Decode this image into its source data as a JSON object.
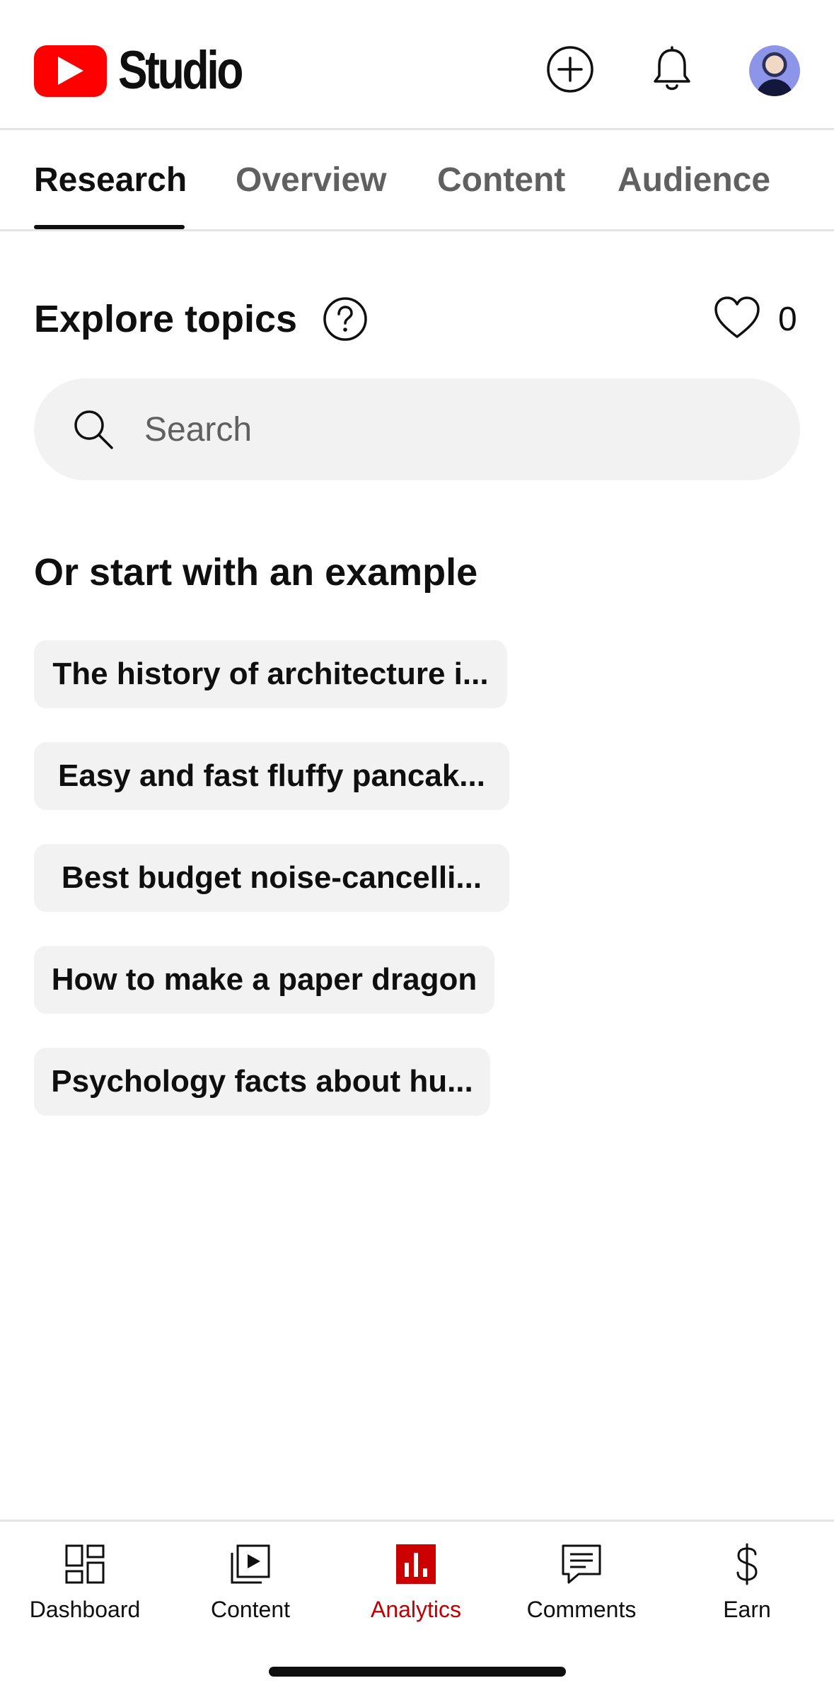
{
  "app": {
    "logo_text": "Studio",
    "accent_color": "#ff0000",
    "active_color": "#c00000"
  },
  "header": {
    "create_icon": "add-circle-icon",
    "notifications_icon": "bell-icon",
    "avatar_icon": "avatar"
  },
  "tabs": [
    {
      "label": "Research",
      "active": true
    },
    {
      "label": "Overview",
      "active": false
    },
    {
      "label": "Content",
      "active": false
    },
    {
      "label": "Audience",
      "active": false
    }
  ],
  "explore": {
    "title": "Explore topics",
    "favorites_count": "0",
    "search_placeholder": "Search"
  },
  "examples": {
    "title": "Or start with an example",
    "chips": [
      "The history of architecture i...",
      "Easy and fast fluffy pancak...",
      "Best budget noise-cancelli...",
      "How to make a paper dragon",
      "Psychology facts about hu..."
    ]
  },
  "bottom_nav": [
    {
      "label": "Dashboard",
      "icon": "dashboard-icon",
      "active": false
    },
    {
      "label": "Content",
      "icon": "video-library-icon",
      "active": false
    },
    {
      "label": "Analytics",
      "icon": "analytics-icon",
      "active": true
    },
    {
      "label": "Comments",
      "icon": "comment-icon",
      "active": false
    },
    {
      "label": "Earn",
      "icon": "dollar-icon",
      "active": false
    }
  ]
}
